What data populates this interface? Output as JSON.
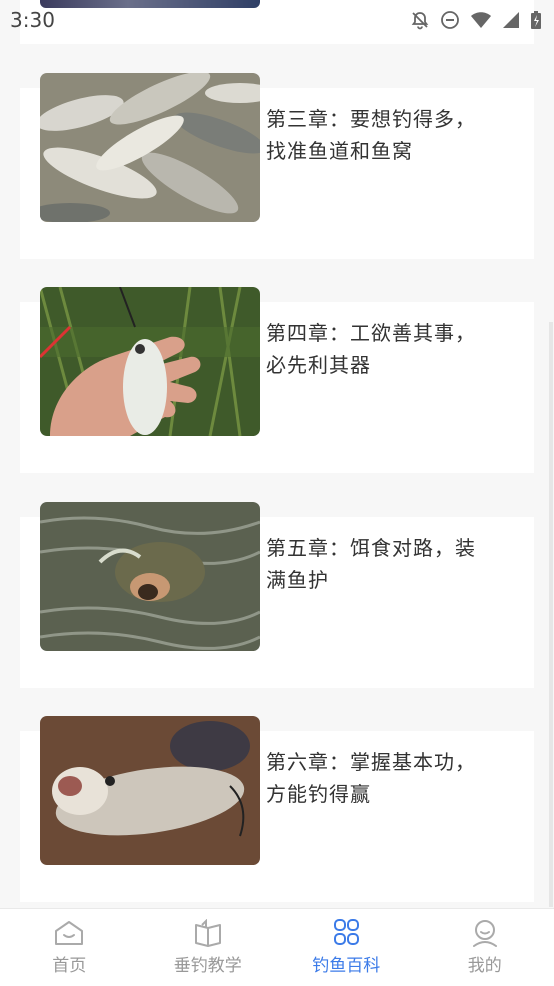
{
  "status": {
    "time": "3:30",
    "icons": [
      "notifications-off-icon",
      "do-not-disturb-icon",
      "wifi-icon",
      "cell-signal-icon",
      "battery-charging-icon"
    ]
  },
  "chapters": [
    {
      "title": "第三章：要想钓得多，找准鱼道和鱼窝",
      "image": "pile-of-carp-photo"
    },
    {
      "title": "第四章：工欲善其事，必先利其器",
      "image": "hand-holding-fish-photo"
    },
    {
      "title": "第五章：饵食对路，装满鱼护",
      "image": "fish-surfacing-water-photo"
    },
    {
      "title": "第六章：掌握基本功，方能钓得赢",
      "image": "fish-on-ground-photo"
    }
  ],
  "bottom_nav": [
    {
      "label": "首页",
      "icon": "home-icon",
      "active": false
    },
    {
      "label": "垂钓教学",
      "icon": "book-icon",
      "active": false
    },
    {
      "label": "钓鱼百科",
      "icon": "grid-apps-icon",
      "active": true
    },
    {
      "label": "我的",
      "icon": "user-icon",
      "active": false
    }
  ],
  "colors": {
    "accent": "#3c7be8",
    "inactive": "#999999",
    "background": "#f7f7f7"
  }
}
